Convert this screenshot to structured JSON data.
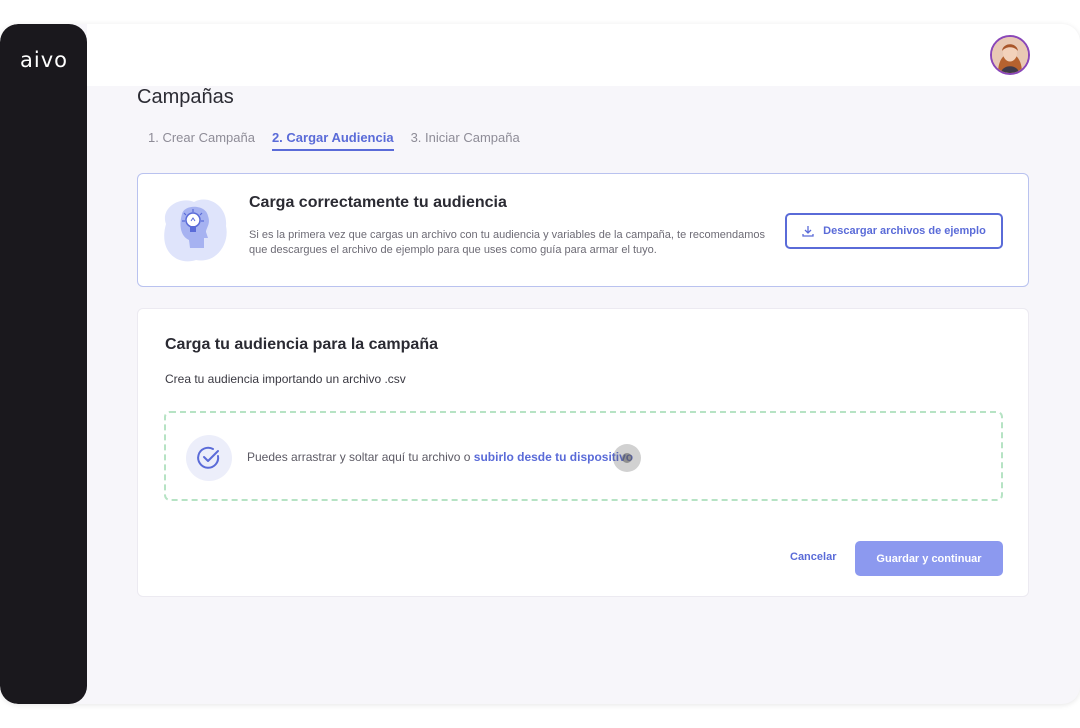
{
  "app": {
    "logo_text": "aivo"
  },
  "header": {
    "avatar_icon": "user-avatar"
  },
  "page": {
    "title": "Campañas"
  },
  "steps": [
    {
      "label": "1. Crear Campaña",
      "active": false
    },
    {
      "label": "2. Cargar Audiencia",
      "active": true
    },
    {
      "label": "3. Iniciar Campaña",
      "active": false
    }
  ],
  "info_card": {
    "title": "Carga correctamente tu audiencia",
    "text": "Si es la primera vez que cargas un archivo con tu audiencia y variables de la campaña, te recomendamos que descargues el archivo de ejemplo para que uses como guía para armar el tuyo.",
    "illustration_icon": "lightbulb-head-icon",
    "download_button": {
      "label": "Descargar archivos de ejemplo",
      "icon": "download-icon"
    }
  },
  "upload_card": {
    "title": "Carga tu audiencia para la campaña",
    "subtitle": "Crea tu audiencia importando un archivo .csv",
    "dropzone": {
      "text": "Puedes arrastrar y soltar aquí tu archivo o ",
      "link": "subirlo desde tu dispositivo",
      "icon": "check-circle-icon"
    },
    "cancel_label": "Cancelar",
    "save_label": "Guardar y continuar"
  },
  "colors": {
    "accent": "#5a6bd8",
    "sidebar": "#1a181d",
    "save_button": "#8c99ef",
    "dropzone_border": "#b6e3c4"
  }
}
